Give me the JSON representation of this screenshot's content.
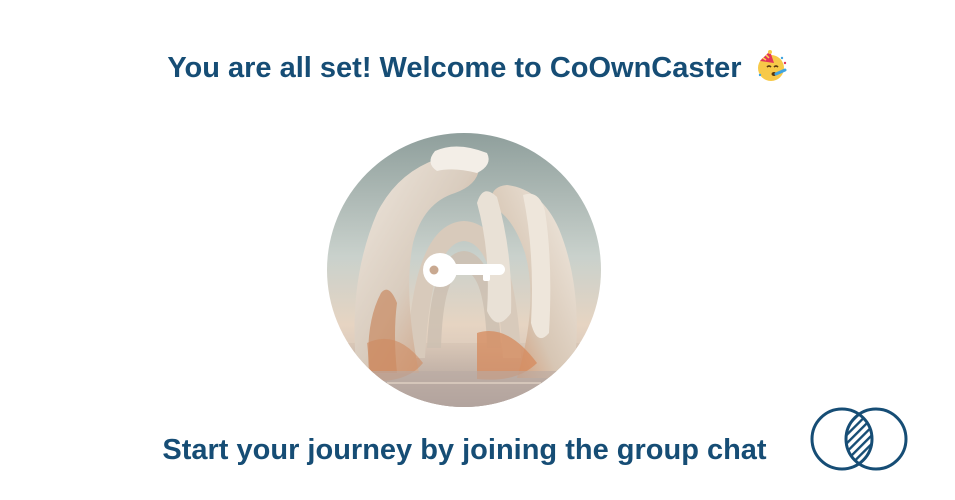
{
  "headline": {
    "text": "You are all set! Welcome to CoOwnCaster",
    "emoji": "party-face-emoji"
  },
  "hero": {
    "image": "hands-arch-key-illustration",
    "icon": "key-icon"
  },
  "cta": {
    "text": "Start your journey by joining the group chat"
  },
  "logo": {
    "icon": "overlapping-circles-logo"
  },
  "colors": {
    "primary": "#164d75",
    "background": "#ffffff"
  }
}
